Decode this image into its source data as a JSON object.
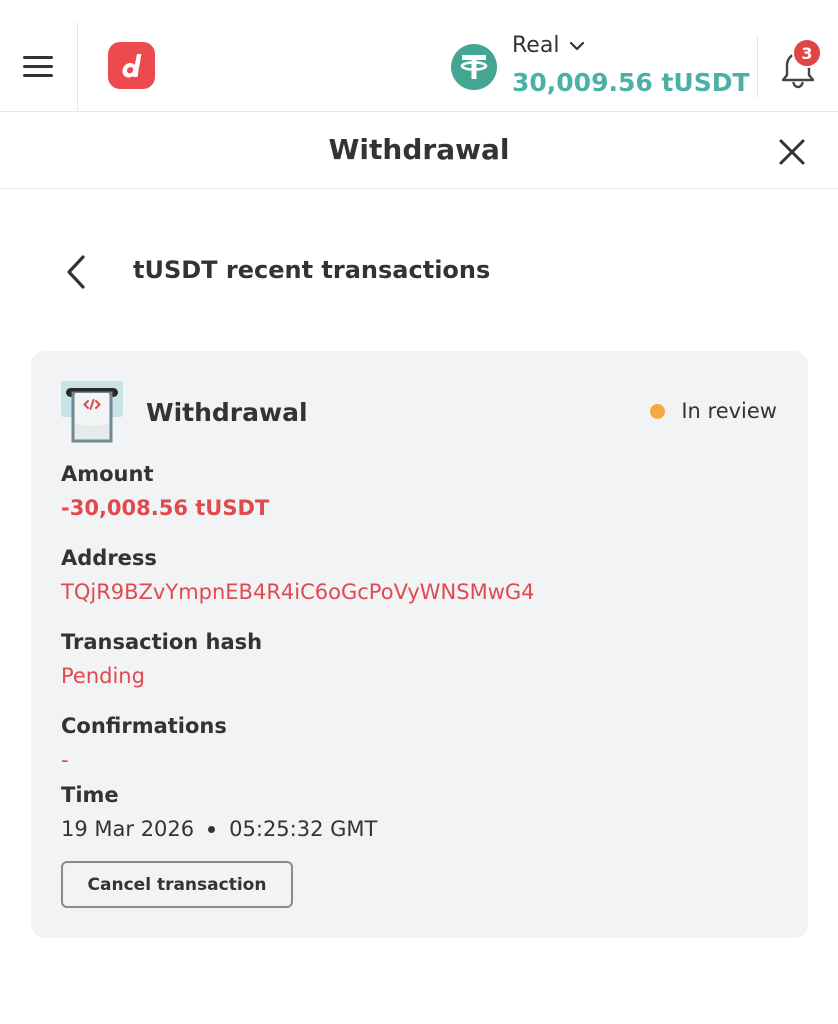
{
  "header": {
    "account_type": "Real",
    "balance": "30,009.56 tUSDT",
    "notification_count": "3"
  },
  "modal": {
    "title": "Withdrawal"
  },
  "subheader": {
    "title": "tUSDT recent transactions"
  },
  "transaction": {
    "type": "Withdrawal",
    "status": "In review",
    "amount_label": "Amount",
    "amount": "-30,008.56 tUSDT",
    "address_label": "Address",
    "address": "TQjR9BZvYmpnEB4R4iC6oGcPoVyWNSMwG4",
    "hash_label": "Transaction hash",
    "hash": "Pending",
    "confirmations_label": "Confirmations",
    "confirmations": "-",
    "time_label": "Time",
    "date": "19 Mar 2026",
    "time": "05:25:32 GMT",
    "cancel_label": "Cancel transaction"
  },
  "colors": {
    "brand_red": "#ec4a4f",
    "tether_green": "#44a592",
    "balance_teal": "#4bb1a5",
    "status_dot": "#f5a742",
    "accent_red": "#e04a4f"
  },
  "icons": [
    "hamburger-icon",
    "deriv-logo",
    "tether-icon",
    "chevron-down-icon",
    "bell-icon",
    "close-icon",
    "back-chevron-icon",
    "withdrawal-atm-icon"
  ]
}
